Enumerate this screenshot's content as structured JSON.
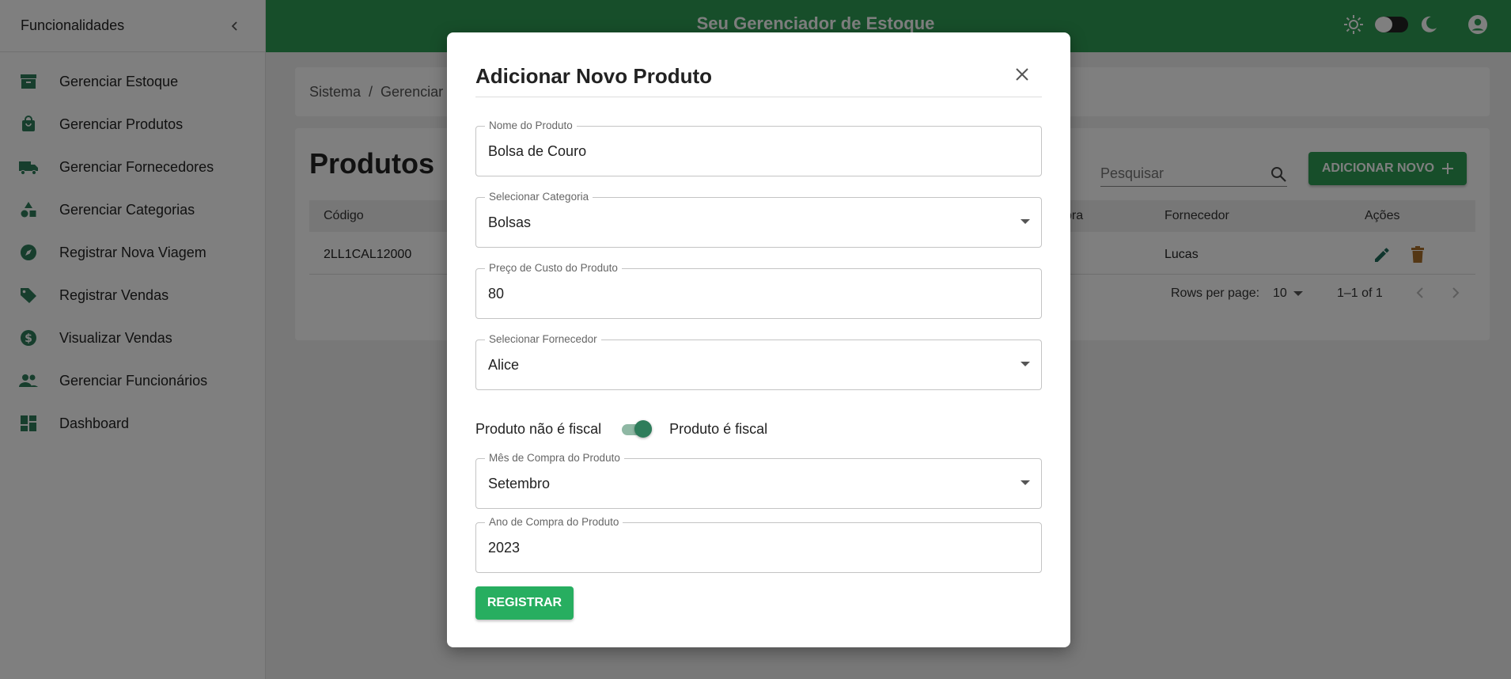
{
  "sidebar": {
    "title": "Funcionalidades",
    "items": [
      {
        "label": "Gerenciar Estoque",
        "icon": "inventory-icon"
      },
      {
        "label": "Gerenciar Produtos",
        "icon": "shopping-bag-icon"
      },
      {
        "label": "Gerenciar Fornecedores",
        "icon": "truck-icon"
      },
      {
        "label": "Gerenciar Categorias",
        "icon": "category-icon"
      },
      {
        "label": "Registrar Nova Viagem",
        "icon": "compass-icon"
      },
      {
        "label": "Registrar Vendas",
        "icon": "tag-icon"
      },
      {
        "label": "Visualizar Vendas",
        "icon": "dollar-icon"
      },
      {
        "label": "Gerenciar Funcionários",
        "icon": "people-icon"
      },
      {
        "label": "Dashboard",
        "icon": "dashboard-icon"
      }
    ]
  },
  "topbar": {
    "title": "Seu Gerenciador de Estoque"
  },
  "breadcrumb": {
    "items": [
      "Sistema",
      "/",
      "Gerenciar"
    ]
  },
  "page": {
    "title": "Produtos",
    "search_placeholder": "Pesquisar",
    "add_button": "ADICIONAR NOVO"
  },
  "table": {
    "headers": {
      "code": "Código",
      "purchase": "pra",
      "supplier": "Fornecedor",
      "actions": "Ações"
    },
    "rows": [
      {
        "code": "2LL1CAL12000",
        "supplier": "Lucas"
      }
    ]
  },
  "pagination": {
    "rows_per_page_label": "Rows per page:",
    "rows_per_page_value": "10",
    "range": "1–1 of 1"
  },
  "modal": {
    "title": "Adicionar Novo Produto",
    "fields": {
      "name": {
        "label": "Nome do Produto",
        "value": "Bolsa de Couro"
      },
      "category": {
        "label": "Selecionar Categoria",
        "value": "Bolsas"
      },
      "cost": {
        "label": "Preço de Custo do Produto",
        "value": "80"
      },
      "supplier": {
        "label": "Selecionar Fornecedor",
        "value": "Alice"
      },
      "month": {
        "label": "Mês de Compra do Produto",
        "value": "Setembro"
      },
      "year": {
        "label": "Ano de Compra do Produto",
        "value": "2023"
      }
    },
    "fiscal": {
      "off_label": "Produto não é fiscal",
      "on_label": "Produto é fiscal",
      "checked": true
    },
    "submit": "REGISTRAR"
  },
  "colors": {
    "primary_green": "#2e9d55",
    "button_green": "#27ae60",
    "edit_icon": "#1e6b5a",
    "delete_icon": "#a86e2a"
  }
}
